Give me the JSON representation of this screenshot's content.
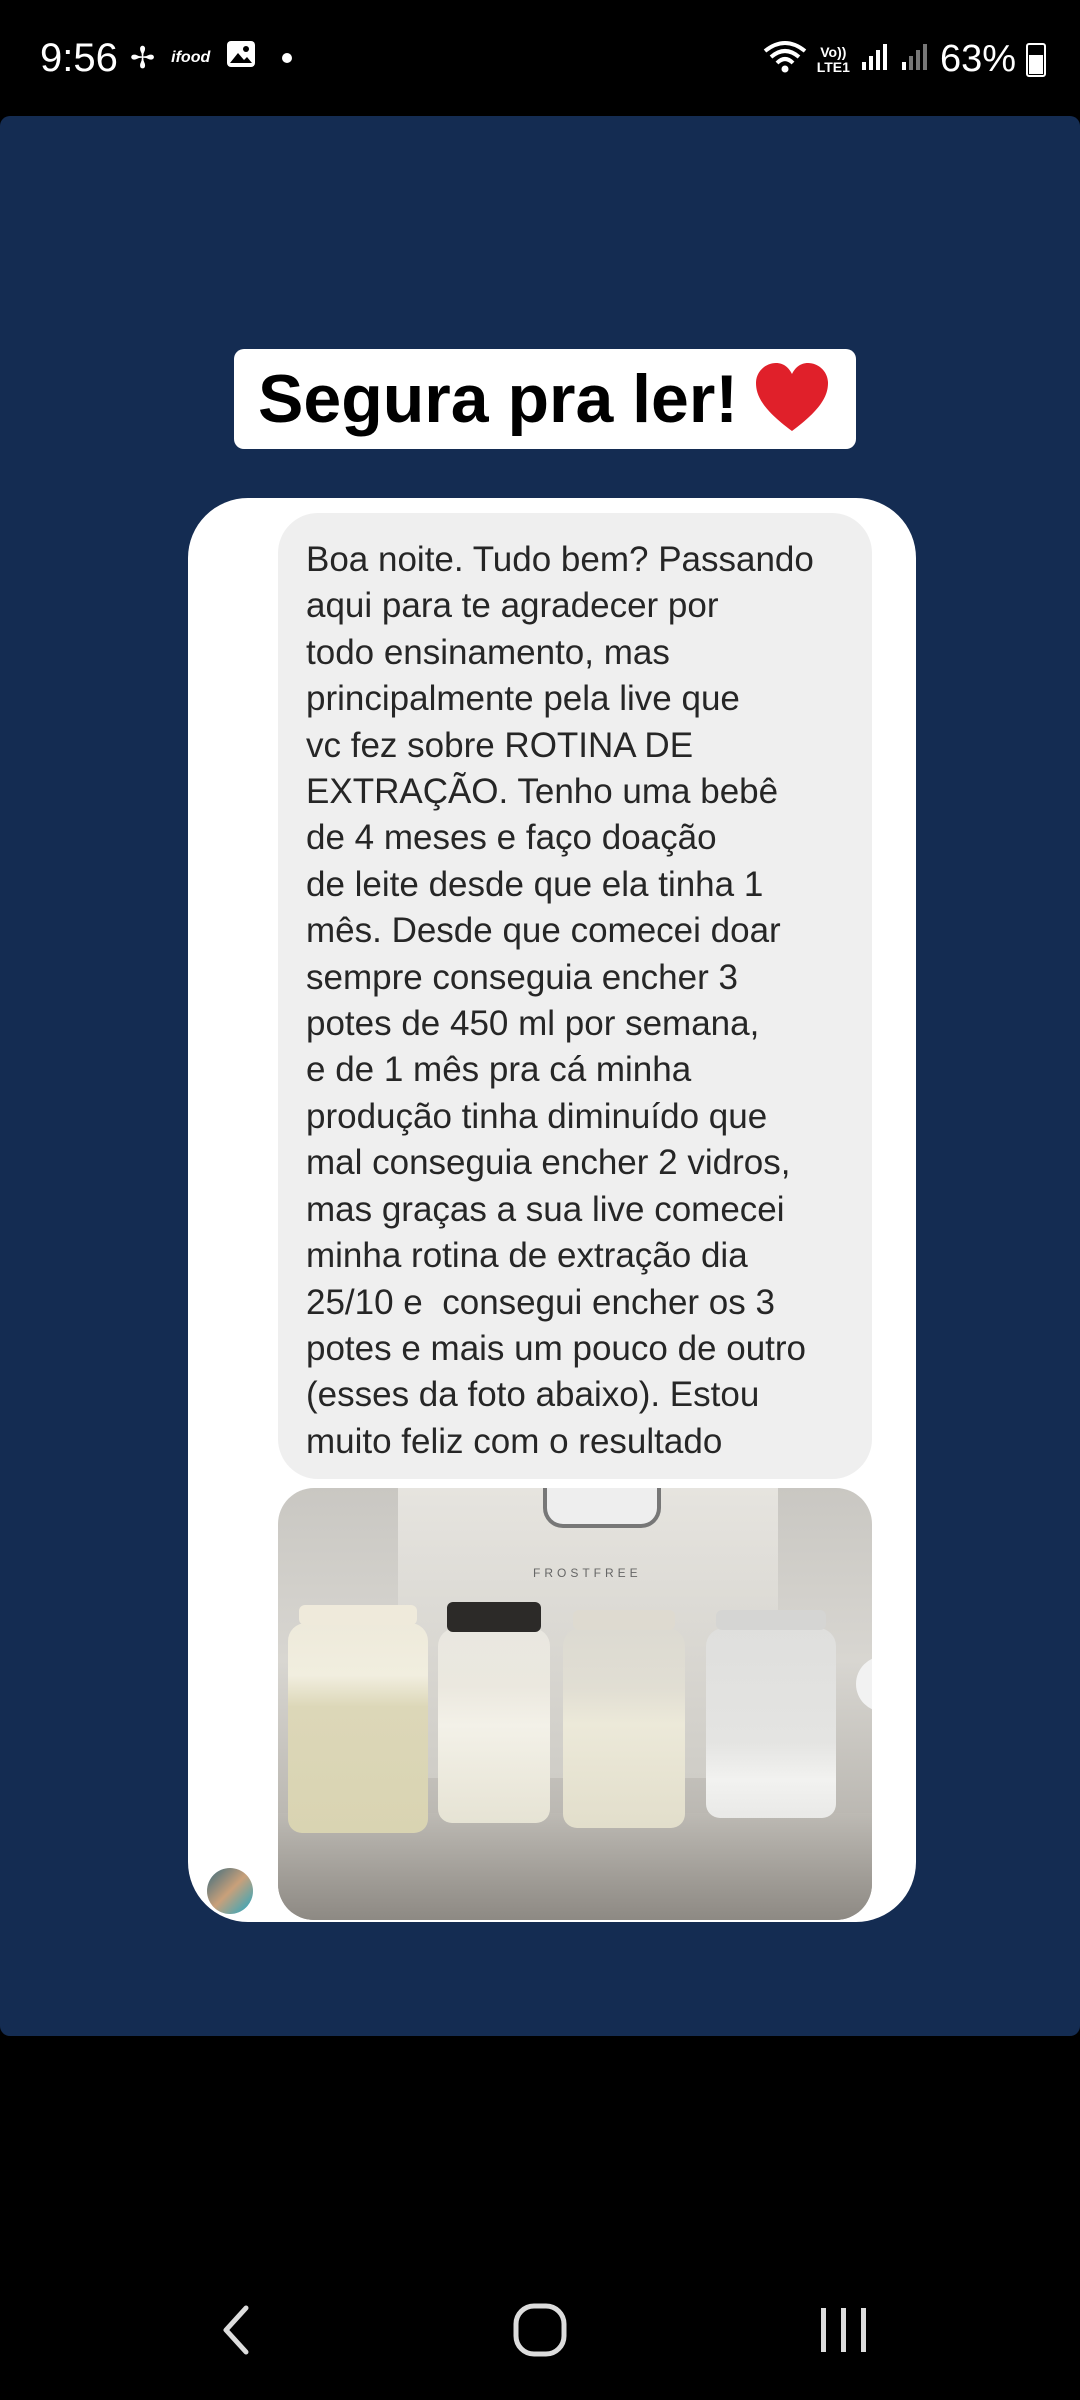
{
  "status_bar": {
    "time": "9:56",
    "left_icons": [
      "pinwheel-icon",
      "ifood-icon",
      "gallery-icon",
      "dot-icon"
    ],
    "ifood_label": "ifood",
    "volte_label": "Vo))\nLTE1",
    "battery_percent": "63%"
  },
  "story": {
    "caption": "Segura pra ler!",
    "caption_emoji": "heart-icon",
    "message_lines": [
      "Boa noite. Tudo bem? Passando",
      "aqui para te agradecer por",
      "todo ensinamento, mas",
      "principalmente pela live que",
      "vc fez sobre ROTINA DE",
      "EXTRAÇÃO. Tenho uma bebê",
      "de 4 meses e faço doação",
      "de leite desde que ela tinha 1",
      "mês. Desde que comecei doar",
      "sempre conseguia encher 3",
      "potes de 450 ml por semana,",
      "e de 1 mês pra cá minha",
      "produção tinha diminuído que",
      "mal conseguia encher 2 vidros,",
      "mas graças a sua live comecei",
      "minha rotina de extração dia",
      "25/10 e  consegui encher os 3",
      "potes e mais um pouco de outro",
      "(esses da foto abaixo). Estou",
      "muito feliz com o resultado"
    ],
    "photo_brand": "FROSTFREE"
  },
  "colors": {
    "story_background": "#142c52",
    "bubble": "#efefef",
    "heart": "#e0202a"
  }
}
